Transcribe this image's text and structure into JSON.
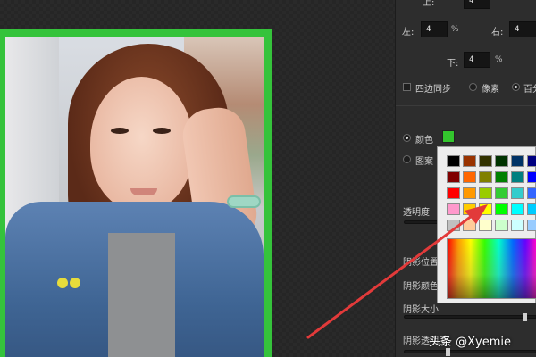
{
  "panel": {
    "top_label": "上:",
    "top_value": "4",
    "left_label": "左:",
    "left_value": "4",
    "right_label": "右:",
    "right_value": "4",
    "bottom_label": "下:",
    "bottom_value": "4",
    "percent": "%",
    "sync_label": "四边同步",
    "unit_pixel": "像素",
    "unit_percent": "百分",
    "fill_color_label": "颜色",
    "fill_pattern_label": "图案",
    "opacity_label": "透明度",
    "shadow_position_label": "阴影位置",
    "shadow_color_label": "阴影颜色",
    "shadow_size_label": "阴影大小",
    "shadow_opacity_label": "阴影透明度"
  },
  "colors": {
    "border_green": "#35c33b",
    "selected_swatch": "#33c52d",
    "arrow": "#e23a3a"
  },
  "picker": {
    "swatches": [
      [
        "#000000",
        "#993300",
        "#333300",
        "#003300",
        "#003366",
        "#000080",
        "#333399"
      ],
      [
        "#800000",
        "#ff6600",
        "#808000",
        "#008000",
        "#008080",
        "#0000ff",
        "#666699"
      ],
      [
        "#ff0000",
        "#ff9900",
        "#99cc00",
        "#33cc33",
        "#33cccc",
        "#3366ff",
        "#800080"
      ],
      [
        "#ff99cc",
        "#ffcc00",
        "#ffff00",
        "#00ff00",
        "#00ffff",
        "#00ccff",
        "#993366"
      ],
      [
        "#c0c0c0",
        "#ffcc99",
        "#ffffcc",
        "#ccffcc",
        "#ccffff",
        "#99ccff",
        "#cc99ff"
      ]
    ]
  },
  "watermark": "头条 @Xyemie",
  "icons": {
    "annotation": "red-arrow-icon"
  }
}
